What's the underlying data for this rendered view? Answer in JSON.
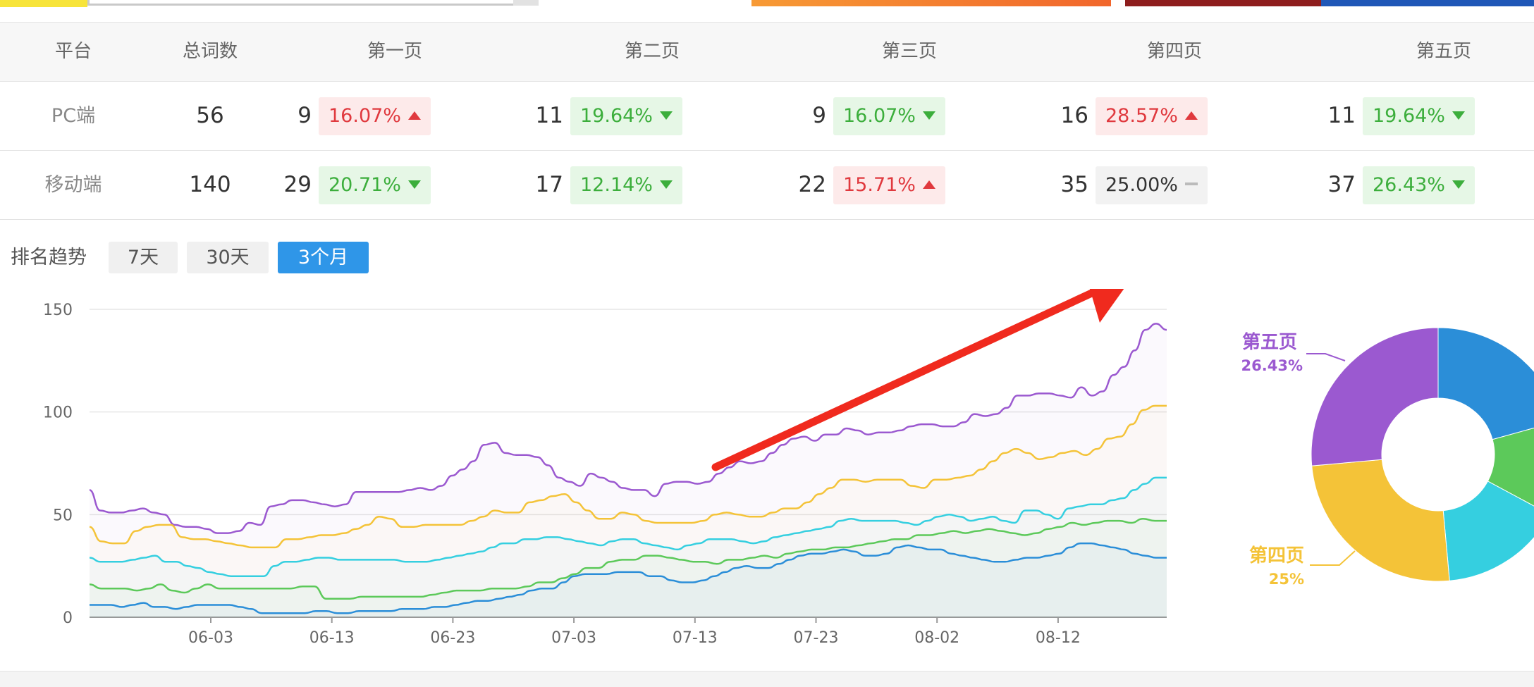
{
  "table": {
    "headers": [
      "平台",
      "总词数",
      "第一页",
      "第二页",
      "第三页",
      "第四页",
      "第五页"
    ],
    "rows": [
      {
        "platform": "PC端",
        "total": "56",
        "pages": [
          {
            "count": "9",
            "pct": "16.07%",
            "trend": "up"
          },
          {
            "count": "11",
            "pct": "19.64%",
            "trend": "down"
          },
          {
            "count": "9",
            "pct": "16.07%",
            "trend": "down"
          },
          {
            "count": "16",
            "pct": "28.57%",
            "trend": "up"
          },
          {
            "count": "11",
            "pct": "19.64%",
            "trend": "down"
          }
        ]
      },
      {
        "platform": "移动端",
        "total": "140",
        "pages": [
          {
            "count": "29",
            "pct": "20.71%",
            "trend": "down"
          },
          {
            "count": "17",
            "pct": "12.14%",
            "trend": "down"
          },
          {
            "count": "22",
            "pct": "15.71%",
            "trend": "up"
          },
          {
            "count": "35",
            "pct": "25.00%",
            "trend": "flat"
          },
          {
            "count": "37",
            "pct": "26.43%",
            "trend": "down"
          }
        ]
      }
    ]
  },
  "trend": {
    "label": "排名趋势",
    "buttons": [
      {
        "label": "7天",
        "active": false
      },
      {
        "label": "30天",
        "active": false
      },
      {
        "label": "3个月",
        "active": true
      }
    ]
  },
  "colors": {
    "purple": "#9b59d0",
    "yellow": "#f4c338",
    "cyan": "#35cfe0",
    "green": "#5cc95a",
    "blue": "#2b8ed8",
    "arrow": "#f02a1e",
    "up": "#e0393e",
    "down": "#3cae3c"
  },
  "chart_data": {
    "type": "line",
    "x_ticks": [
      "06-03",
      "06-13",
      "06-23",
      "07-03",
      "07-13",
      "07-23",
      "08-02",
      "08-12"
    ],
    "ylim": [
      0,
      150
    ],
    "y_ticks": [
      0,
      50,
      100,
      150
    ],
    "grid": true,
    "series": [
      {
        "color": "#9b59d0",
        "values": [
          62,
          52,
          51,
          51,
          52,
          53,
          51,
          50,
          45,
          44,
          44,
          43,
          41,
          41,
          42,
          46,
          45,
          54,
          55,
          57,
          57,
          56,
          55,
          54,
          55,
          61,
          61,
          61,
          61,
          61,
          62,
          63,
          62,
          64,
          69,
          72,
          76,
          84,
          85,
          80,
          79,
          79,
          78,
          74,
          68,
          66,
          64,
          70,
          68,
          66,
          63,
          62,
          62,
          59,
          65,
          66,
          66,
          65,
          66,
          70,
          73,
          76,
          75,
          76,
          80,
          84,
          87,
          88,
          86,
          89,
          89,
          92,
          91,
          89,
          90,
          90,
          91,
          93,
          94,
          94,
          93,
          93,
          95,
          99,
          98,
          99,
          102,
          108,
          108,
          109,
          109,
          108,
          107,
          112,
          108,
          110,
          118,
          122,
          130,
          140,
          143,
          140
        ]
      },
      {
        "color": "#f4c338",
        "values": [
          44,
          37,
          36,
          36,
          42,
          44,
          45,
          45,
          39,
          38,
          38,
          37,
          36,
          35,
          34,
          34,
          34,
          38,
          38,
          39,
          40,
          40,
          41,
          43,
          45,
          49,
          48,
          44,
          44,
          45,
          45,
          45,
          45,
          47,
          49,
          52,
          51,
          51,
          56,
          57,
          59,
          60,
          56,
          52,
          48,
          48,
          51,
          50,
          47,
          46,
          46,
          46,
          46,
          47,
          50,
          51,
          50,
          49,
          49,
          51,
          53,
          53,
          56,
          60,
          63,
          67,
          67,
          66,
          67,
          67,
          67,
          64,
          63,
          67,
          67,
          68,
          69,
          72,
          76,
          80,
          82,
          80,
          77,
          78,
          80,
          81,
          79,
          82,
          87,
          88,
          94,
          101,
          103,
          103
        ]
      },
      {
        "color": "#35cfe0",
        "values": [
          29,
          27,
          27,
          27,
          28,
          29,
          30,
          27,
          27,
          25,
          24,
          22,
          21,
          20,
          20,
          20,
          20,
          25,
          27,
          27,
          28,
          29,
          29,
          28,
          28,
          28,
          28,
          28,
          28,
          27,
          27,
          27,
          28,
          29,
          30,
          31,
          32,
          34,
          36,
          36,
          38,
          38,
          39,
          39,
          38,
          37,
          36,
          35,
          37,
          38,
          38,
          36,
          35,
          34,
          33,
          35,
          36,
          38,
          38,
          38,
          37,
          36,
          37,
          39,
          40,
          41,
          42,
          43,
          44,
          47,
          48,
          47,
          47,
          47,
          47,
          46,
          45,
          47,
          49,
          50,
          49,
          47,
          48,
          49,
          47,
          46,
          52,
          52,
          50,
          48,
          53,
          54,
          55,
          55,
          57,
          58,
          62,
          65,
          68,
          68
        ]
      },
      {
        "color": "#5cc95a",
        "values": [
          16,
          14,
          14,
          14,
          13,
          14,
          16,
          13,
          12,
          14,
          16,
          14,
          14,
          14,
          14,
          14,
          14,
          14,
          15,
          15,
          9,
          9,
          9,
          10,
          10,
          10,
          10,
          10,
          10,
          11,
          12,
          13,
          13,
          13,
          14,
          14,
          14,
          15,
          17,
          17,
          19,
          21,
          24,
          24,
          27,
          28,
          28,
          30,
          30,
          29,
          28,
          27,
          27,
          26,
          28,
          28,
          29,
          30,
          29,
          31,
          32,
          33,
          33,
          34,
          34,
          35,
          36,
          37,
          38,
          38,
          40,
          40,
          41,
          42,
          41,
          42,
          43,
          42,
          41,
          40,
          41,
          43,
          44,
          46,
          45,
          46,
          47,
          47,
          46,
          48,
          47,
          47
        ]
      },
      {
        "color": "#2b8ed8",
        "values": [
          6,
          6,
          6,
          5,
          6,
          7,
          5,
          5,
          4,
          5,
          6,
          6,
          6,
          6,
          5,
          4,
          2,
          2,
          2,
          2,
          2,
          3,
          3,
          2,
          2,
          3,
          3,
          3,
          3,
          4,
          4,
          4,
          5,
          5,
          6,
          7,
          8,
          8,
          9,
          10,
          11,
          13,
          14,
          14,
          17,
          20,
          21,
          21,
          21,
          22,
          22,
          22,
          20,
          20,
          18,
          17,
          17,
          18,
          20,
          22,
          24,
          25,
          24,
          24,
          26,
          28,
          30,
          31,
          31,
          32,
          33,
          32,
          30,
          30,
          31,
          34,
          35,
          34,
          33,
          33,
          31,
          30,
          29,
          28,
          27,
          27,
          28,
          29,
          29,
          30,
          31,
          34,
          36,
          36,
          35,
          34,
          33,
          31,
          30,
          29,
          29
        ]
      }
    ]
  },
  "pie": {
    "labels": [
      {
        "name": "第五页",
        "pct": "26.43%",
        "color": "#9b59d0"
      },
      {
        "name": "第四页",
        "pct": "25%",
        "color": "#f4c338"
      }
    ]
  }
}
